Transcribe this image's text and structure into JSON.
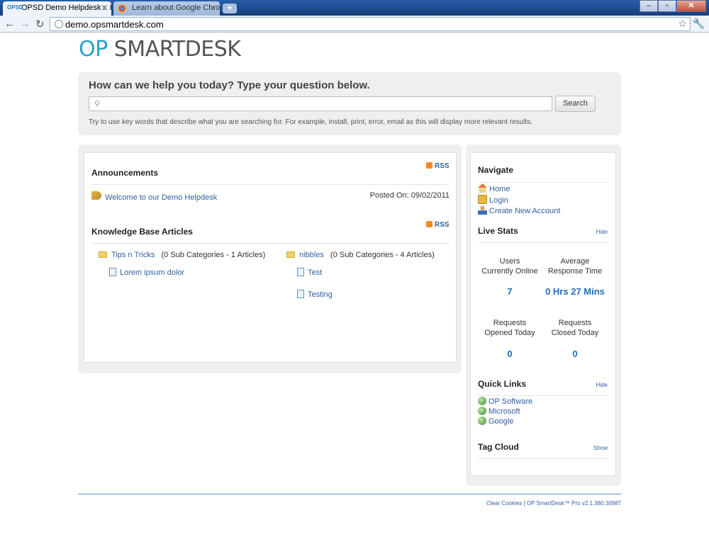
{
  "browser": {
    "tabs": [
      {
        "label": "OPSD Demo Helpdesk :: Ho",
        "favicon": "OPSD",
        "active": true
      },
      {
        "label": "Learn about Google Chrom",
        "favicon": "chrome-icon",
        "active": false
      }
    ],
    "url": "demo.opsmartdesk.com"
  },
  "logo": {
    "part1": "OP",
    "part2": "SMARTDESK"
  },
  "search": {
    "heading": "How can we help you today? Type your question below.",
    "input_value": "",
    "button": "Search",
    "hint": "Try to use key words that describe what you are searching for. For example, install, print, error, email as this will display more relevant results."
  },
  "announcements": {
    "title": "Announcements",
    "rss": "RSS",
    "items": [
      {
        "title": "Welcome to our Demo Helpdesk",
        "posted": "Posted On: 09/02/2011"
      }
    ]
  },
  "kb": {
    "title": "Knowledge Base Articles",
    "rss": "RSS",
    "categories": [
      {
        "name": "Tips n Tricks",
        "meta": "(0 Sub Categories - 1 Articles)",
        "articles": [
          "Lorem ipsum dolor"
        ]
      },
      {
        "name": "nibbles",
        "meta": "(0 Sub Categories - 4 Articles)",
        "articles": [
          "Test",
          "Testing"
        ]
      }
    ]
  },
  "navigate": {
    "title": "Navigate",
    "items": [
      "Home",
      "Login",
      "Create New Account"
    ]
  },
  "live_stats": {
    "title": "Live Stats",
    "toggle": "Hide",
    "stats": [
      {
        "label1": "Users",
        "label2": "Currently Online",
        "value": "7"
      },
      {
        "label1": "Average",
        "label2": "Response Time",
        "value": "0 Hrs 27 Mins"
      },
      {
        "label1": "Requests",
        "label2": "Opened Today",
        "value": "0"
      },
      {
        "label1": "Requests",
        "label2": "Closed Today",
        "value": "0"
      }
    ]
  },
  "quick_links": {
    "title": "Quick Links",
    "toggle": "Hide",
    "items": [
      "OP Software",
      "Microsoft",
      "Google"
    ]
  },
  "tag_cloud": {
    "title": "Tag Cloud",
    "toggle": "Show"
  },
  "footer": {
    "text": "Clear Cookies | OP SmartDesk™ Pro v2.1.380.30987"
  }
}
